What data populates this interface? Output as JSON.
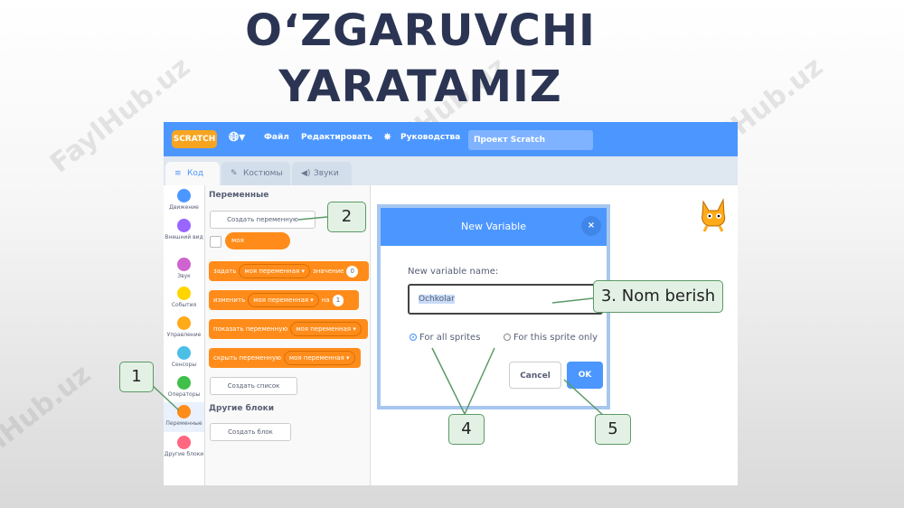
{
  "title": {
    "line1": "O‘ZGARUVCHI",
    "line2": "YARATAMIZ"
  },
  "watermark": "FaylHub.uz",
  "menubar": {
    "logo": "SCRATCH",
    "file": "Файл",
    "edit": "Редактировать",
    "tutorials": "Руководства",
    "project_name": "Проект Scratch",
    "color": "#4c97ff"
  },
  "tabs": [
    {
      "label": "Код"
    },
    {
      "label": "Костюмы"
    },
    {
      "label": "Звуки"
    }
  ],
  "categories": [
    {
      "label": "Движение",
      "color": "#4c97ff"
    },
    {
      "label": "Внешний вид",
      "color": "#9966ff"
    },
    {
      "label": "Звук",
      "color": "#cf63cf"
    },
    {
      "label": "События",
      "color": "#ffd500"
    },
    {
      "label": "Управление",
      "color": "#ffab19"
    },
    {
      "label": "Сенсоры",
      "color": "#4cbfe6"
    },
    {
      "label": "Операторы",
      "color": "#40bf4a"
    },
    {
      "label": "Переменные",
      "color": "#ff8c1a"
    },
    {
      "label": "Другие блоки",
      "color": "#ff6680"
    }
  ],
  "palette": {
    "heading": "Переменные",
    "make_variable": "Создать переменную",
    "my_variable": "моя переменная",
    "set_block": {
      "prefix": "задать",
      "var": "моя переменная",
      "mid": "значение",
      "value": "0"
    },
    "change_block": {
      "prefix": "изменить",
      "var": "моя переменная",
      "mid": "на",
      "value": "1"
    },
    "show_block": {
      "prefix": "показать переменную",
      "var": "моя переменная"
    },
    "hide_block": {
      "prefix": "скрыть переменную",
      "var": "моя переменная"
    },
    "make_list": "Создать список",
    "other_heading": "Другие блоки",
    "make_block": "Создать блок"
  },
  "dialog": {
    "title": "New Variable",
    "close": "×",
    "label": "New variable name:",
    "value": "Ochkolar",
    "option_all": "For all sprites",
    "option_this": "For this sprite only",
    "cancel": "Cancel",
    "ok": "OK"
  },
  "callouts": {
    "c1": "1",
    "c2": "2",
    "c3": "3. Nom berish",
    "c4": "4",
    "c5": "5"
  }
}
